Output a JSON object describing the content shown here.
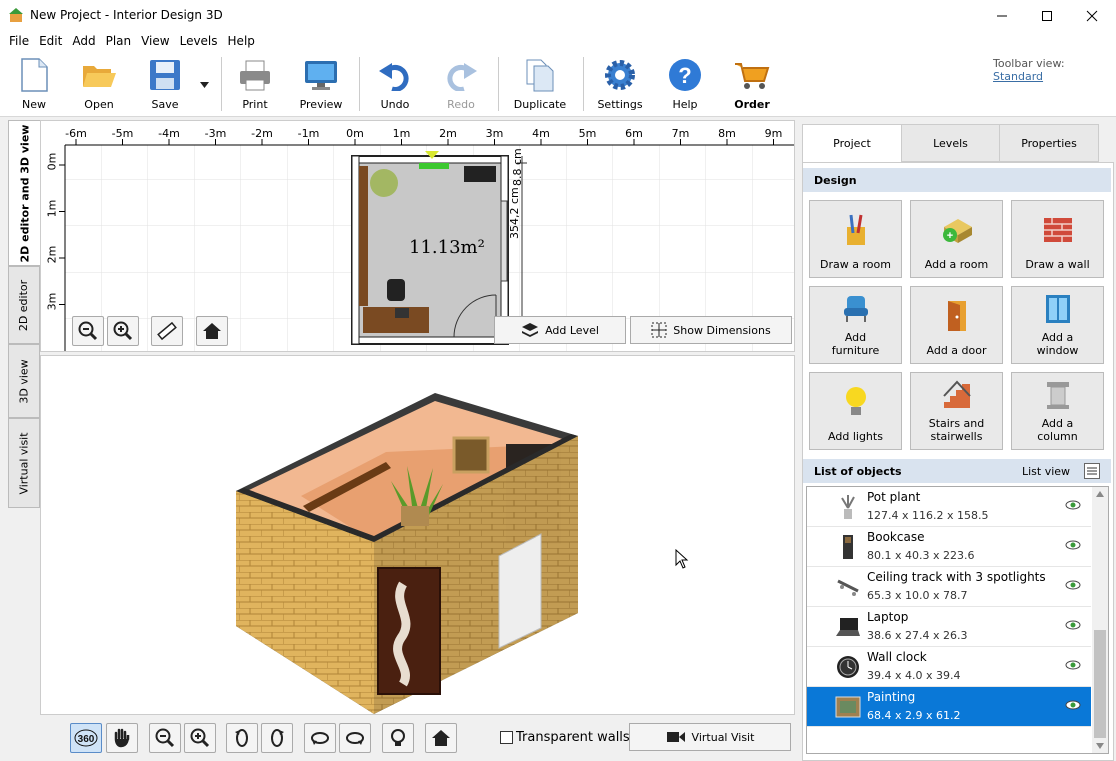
{
  "window": {
    "title": "New Project - Interior Design 3D"
  },
  "menu": [
    "File",
    "Edit",
    "Add",
    "Plan",
    "View",
    "Levels",
    "Help"
  ],
  "toolbar": {
    "buttons": [
      "New",
      "Open",
      "Save",
      "Print",
      "Preview",
      "Undo",
      "Redo",
      "Duplicate",
      "Settings",
      "Help",
      "Order"
    ],
    "view_label": "Toolbar view:",
    "view_value": "Standard"
  },
  "vtabs": [
    "2D editor and 3D view",
    "2D editor",
    "3D view",
    "Virtual visit"
  ],
  "plan": {
    "ruler_x": [
      "-6m",
      "-5m",
      "-4m",
      "-3m",
      "-2m",
      "-1m",
      "0m",
      "1m",
      "2m",
      "3m",
      "4m",
      "5m",
      "6m",
      "7m",
      "8m",
      "9m"
    ],
    "ruler_y": [
      "0m",
      "1m",
      "2m",
      "3m"
    ],
    "area": "11.13m²",
    "dim_v": "354,2 cm",
    "dim_top": "8.8 cm",
    "add_level": "Add Level",
    "show_dims": "Show Dimensions"
  },
  "bottom": {
    "transparent_walls": "Transparent walls",
    "virtual_visit": "Virtual Visit"
  },
  "right": {
    "tabs": [
      "Project",
      "Levels",
      "Properties"
    ],
    "design_header": "Design",
    "design_buttons": [
      {
        "l1": "Draw a room",
        "l2": ""
      },
      {
        "l1": "Add a room",
        "l2": ""
      },
      {
        "l1": "Draw a wall",
        "l2": ""
      },
      {
        "l1": "Add",
        "l2": "furniture"
      },
      {
        "l1": "Add a door",
        "l2": ""
      },
      {
        "l1": "Add a",
        "l2": "window"
      },
      {
        "l1": "Add lights",
        "l2": ""
      },
      {
        "l1": "Stairs and",
        "l2": "stairwells"
      },
      {
        "l1": "Add a",
        "l2": "column"
      }
    ],
    "list_header": "List of objects",
    "list_view": "List view",
    "objects": [
      {
        "name": "Pot plant",
        "dims": "127.4 x 116.2 x 158.5"
      },
      {
        "name": "Bookcase",
        "dims": "80.1 x 40.3 x 223.6"
      },
      {
        "name": "Ceiling track with 3 spotlights",
        "dims": "65.3 x 10.0 x 78.7"
      },
      {
        "name": "Laptop",
        "dims": "38.6 x 27.4 x 26.3"
      },
      {
        "name": "Wall clock",
        "dims": "39.4 x 4.0 x 39.4"
      },
      {
        "name": "Painting",
        "dims": "68.4 x 2.9 x 61.2"
      }
    ]
  }
}
